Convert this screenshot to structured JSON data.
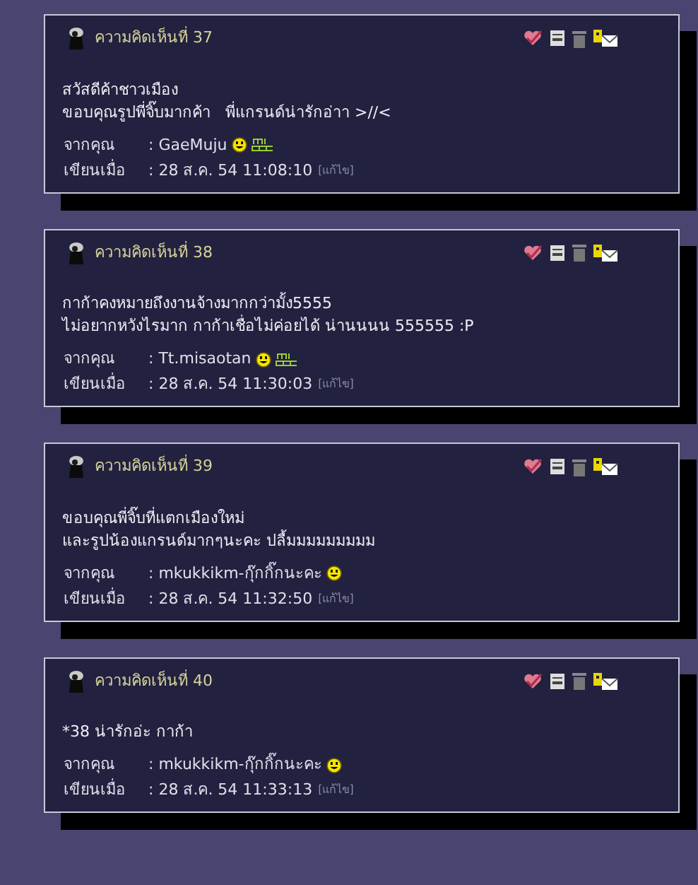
{
  "comments": [
    {
      "title": "ความคิดเห็นที่ 37",
      "body": [
        "สวัสดีค้าชาวเมือง",
        "ขอบคุณรูปพี่จิ๊บมากค้า   พี่แกรนด์น่ารักอ่าา >//<"
      ],
      "from_label": "จากคุณ",
      "from": ": GaeMuju",
      "smiley": true,
      "blog": true,
      "time_label": "เขียนเมื่อ",
      "time": ": 28 ส.ค. 54 11:08:10",
      "edit": "[แก้ไข]"
    },
    {
      "title": "ความคิดเห็นที่ 38",
      "body": [
        "กาก้าคงหมายถึงงานจ้างมากกว่ามั้ง5555",
        "ไม่อยากหวังไรมาก กาก้าเชื่อไม่ค่อยได้ น่านนนน 555555 :P"
      ],
      "from_label": "จากคุณ",
      "from": ": Tt.misaotan",
      "smiley": true,
      "blog": true,
      "time_label": "เขียนเมื่อ",
      "time": ": 28 ส.ค. 54 11:30:03",
      "edit": "[แก้ไข]"
    },
    {
      "title": "ความคิดเห็นที่ 39",
      "body": [
        "ขอบคุณพี่จิ๊บที่แตกเมืองใหม่",
        "และรูปน้องแกรนด์มากๆนะคะ ปลื้มมมมมมมมม"
      ],
      "from_label": "จากคุณ",
      "from": ": mkukkikm-กุ๊กกิ๊กนะคะ",
      "smiley": true,
      "blog": false,
      "time_label": "เขียนเมื่อ",
      "time": ": 28 ส.ค. 54 11:32:50",
      "edit": "[แก้ไข]"
    },
    {
      "title": "ความคิดเห็นที่ 40",
      "body": [
        "*38 น่ารักอ่ะ กาก้า"
      ],
      "from_label": "จากคุณ",
      "from": ": mkukkikm-กุ๊กกิ๊กนะคะ",
      "smiley": true,
      "blog": false,
      "time_label": "เขียนเมื่อ",
      "time": ": 28 ส.ค. 54 11:33:13",
      "edit": "[แก้ไข]"
    }
  ]
}
